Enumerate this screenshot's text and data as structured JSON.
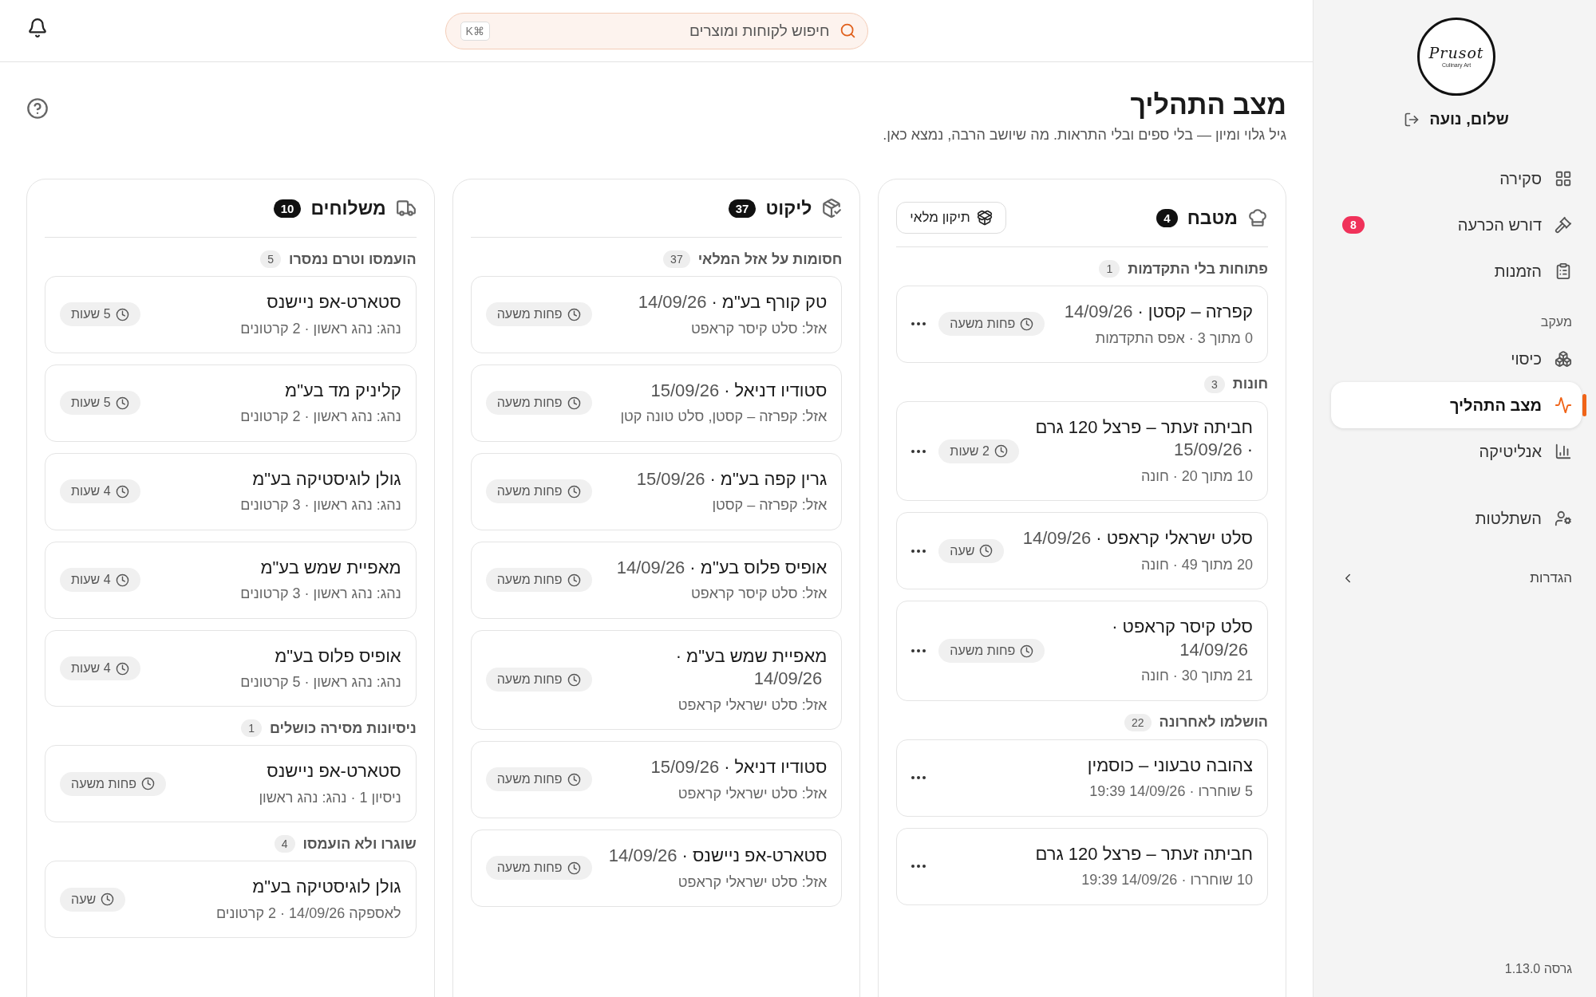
{
  "topbar": {
    "search": {
      "placeholder": "חיפוש לקוחות ומוצרים",
      "shortcut": "⌘K"
    }
  },
  "page": {
    "title": "מצב התהליך",
    "subtitle": "גיל גלוי ומיון — בלי ספים ובלי התראות. מה שיושב הרבה, נמצא כאן."
  },
  "columns": [
    {
      "title": "מטבח",
      "count": "4",
      "action": "תיקון מלאי",
      "card_menu": true,
      "groups": [
        {
          "label": "פתוחות בלי התקדמות",
          "count": "1",
          "cards": [
            {
              "title": "קפרזה – קסטן ·",
              "date": "14/09/26",
              "meta": "0 מתוך 3 · אפס התקדמות",
              "age": "פחות משעה"
            }
          ]
        },
        {
          "label": "חונות",
          "count": "3",
          "cards": [
            {
              "title": "חביתה זעתר – פרצל 120 גרם ·",
              "date": "15/09/26",
              "meta": "10 מתוך 20 · חונה",
              "age": "2 שעות"
            },
            {
              "title": "סלט ישראלי קראפט ·",
              "date": "14/09/26",
              "meta": "20 מתוך 49 · חונה",
              "age": "שעה"
            },
            {
              "title": "סלט קיסר קראפט ·",
              "date": "14/09/26",
              "meta": "21 מתוך 30 · חונה",
              "age": "פחות משעה"
            }
          ]
        },
        {
          "label": "הושלמו לאחרונה",
          "count": "22",
          "cards": [
            {
              "title": "צהובה טבעוני – כוסמין",
              "meta": "5 שוחררו · 14/09/26 19:39"
            },
            {
              "title": "חביתה זעתר – פרצל 120 גרם",
              "meta": "10 שוחררו · 14/09/26 19:39"
            }
          ]
        }
      ]
    },
    {
      "title": "ליקוט",
      "count": "37",
      "card_menu": false,
      "groups": [
        {
          "label": "חסומות על אזל המלאי",
          "count": "37",
          "cards": [
            {
              "title": "טק קורף בע\"מ ·",
              "date": "14/09/26",
              "meta": "אזל: סלט קיסר קראפט",
              "age": "פחות משעה"
            },
            {
              "title": "סטודיו דניאל ·",
              "date": "15/09/26",
              "meta": "אזל: קפרזה – קסטן, סלט טונה קטן",
              "age": "פחות משעה"
            },
            {
              "title": "גרין קפה בע\"מ ·",
              "date": "15/09/26",
              "meta": "אזל: קפרזה – קסטן",
              "age": "פחות משעה"
            },
            {
              "title": "אופיס פלוס בע\"מ ·",
              "date": "14/09/26",
              "meta": "אזל: סלט קיסר קראפט",
              "age": "פחות משעה"
            },
            {
              "title": "מאפיית שמש בע\"מ ·",
              "date": "14/09/26",
              "meta": "אזל: סלט ישראלי קראפט",
              "age": "פחות משעה"
            },
            {
              "title": "סטודיו דניאל ·",
              "date": "15/09/26",
              "meta": "אזל: סלט ישראלי קראפט",
              "age": "פחות משעה"
            },
            {
              "title": "סטארט-אפ ניישנס ·",
              "date": "14/09/26",
              "meta": "אזל: סלט ישראלי קראפט",
              "age": "פחות משעה"
            }
          ]
        }
      ]
    },
    {
      "title": "משלוחים",
      "count": "10",
      "card_menu": false,
      "groups": [
        {
          "label": "הועמסו וטרם נמסרו",
          "count": "5",
          "cards": [
            {
              "title": "סטארט-אפ ניישנס",
              "meta": "נהג: נהג ראשון · 2 קרטונים",
              "age": "5 שעות"
            },
            {
              "title": "קליניק מד בע\"מ",
              "meta": "נהג: נהג ראשון · 2 קרטונים",
              "age": "5 שעות"
            },
            {
              "title": "גולן לוגיסטיקה בע\"מ",
              "meta": "נהג: נהג ראשון · 3 קרטונים",
              "age": "4 שעות"
            },
            {
              "title": "מאפיית שמש בע\"מ",
              "meta": "נהג: נהג ראשון · 3 קרטונים",
              "age": "4 שעות"
            },
            {
              "title": "אופיס פלוס בע\"מ",
              "meta": "נהג: נהג ראשון · 5 קרטונים",
              "age": "4 שעות"
            }
          ]
        },
        {
          "label": "ניסיונות מסירה כושלים",
          "count": "1",
          "cards": [
            {
              "title": "סטארט-אפ ניישנס",
              "meta": "ניסיון 1 · נהג: נהג ראשון",
              "age": "פחות משעה"
            }
          ]
        },
        {
          "label": "שוגרו ולא הועמסו",
          "count": "4",
          "cards": [
            {
              "title": "גולן לוגיסטיקה בע\"מ",
              "meta": "לאספקה 14/09/26 · 2 קרטונים",
              "age": "שעה"
            }
          ]
        }
      ]
    }
  ],
  "sidebar": {
    "logo": {
      "text": "Prusot",
      "tagline": "Culinary Art"
    },
    "greeting": "שלום, נועה",
    "groups": [
      {
        "items": [
          {
            "label": "סקירה",
            "selected": false
          },
          {
            "label": "דורש הכרעה",
            "selected": false,
            "badge": "8"
          },
          {
            "label": "הזמנות",
            "selected": false
          }
        ]
      },
      {
        "title": "מעקב",
        "items": [
          {
            "label": "כיסוי",
            "selected": false
          },
          {
            "label": "מצב התהליך",
            "selected": true
          },
          {
            "label": "אנליטיקה",
            "selected": false
          }
        ]
      },
      {
        "items": [
          {
            "label": "השתלטות",
            "selected": false
          }
        ]
      }
    ],
    "settings": {
      "label": "הגדרות",
      "expanded": false
    },
    "version": "גרסה 1.13.0"
  }
}
